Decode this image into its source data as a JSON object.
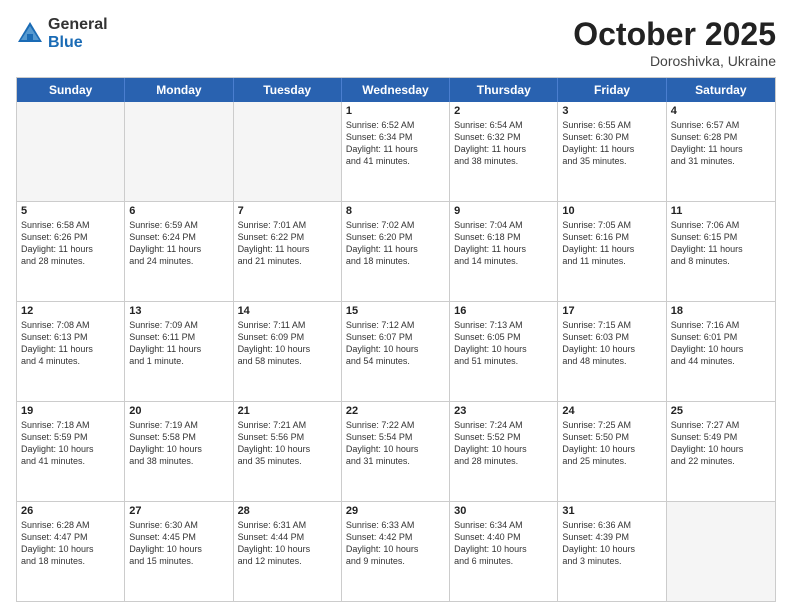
{
  "logo": {
    "general": "General",
    "blue": "Blue"
  },
  "title": "October 2025",
  "location": "Doroshivka, Ukraine",
  "days": [
    "Sunday",
    "Monday",
    "Tuesday",
    "Wednesday",
    "Thursday",
    "Friday",
    "Saturday"
  ],
  "weeks": [
    [
      {
        "day": "",
        "data": ""
      },
      {
        "day": "",
        "data": ""
      },
      {
        "day": "",
        "data": ""
      },
      {
        "day": "1",
        "data": "Sunrise: 6:52 AM\nSunset: 6:34 PM\nDaylight: 11 hours\nand 41 minutes."
      },
      {
        "day": "2",
        "data": "Sunrise: 6:54 AM\nSunset: 6:32 PM\nDaylight: 11 hours\nand 38 minutes."
      },
      {
        "day": "3",
        "data": "Sunrise: 6:55 AM\nSunset: 6:30 PM\nDaylight: 11 hours\nand 35 minutes."
      },
      {
        "day": "4",
        "data": "Sunrise: 6:57 AM\nSunset: 6:28 PM\nDaylight: 11 hours\nand 31 minutes."
      }
    ],
    [
      {
        "day": "5",
        "data": "Sunrise: 6:58 AM\nSunset: 6:26 PM\nDaylight: 11 hours\nand 28 minutes."
      },
      {
        "day": "6",
        "data": "Sunrise: 6:59 AM\nSunset: 6:24 PM\nDaylight: 11 hours\nand 24 minutes."
      },
      {
        "day": "7",
        "data": "Sunrise: 7:01 AM\nSunset: 6:22 PM\nDaylight: 11 hours\nand 21 minutes."
      },
      {
        "day": "8",
        "data": "Sunrise: 7:02 AM\nSunset: 6:20 PM\nDaylight: 11 hours\nand 18 minutes."
      },
      {
        "day": "9",
        "data": "Sunrise: 7:04 AM\nSunset: 6:18 PM\nDaylight: 11 hours\nand 14 minutes."
      },
      {
        "day": "10",
        "data": "Sunrise: 7:05 AM\nSunset: 6:16 PM\nDaylight: 11 hours\nand 11 minutes."
      },
      {
        "day": "11",
        "data": "Sunrise: 7:06 AM\nSunset: 6:15 PM\nDaylight: 11 hours\nand 8 minutes."
      }
    ],
    [
      {
        "day": "12",
        "data": "Sunrise: 7:08 AM\nSunset: 6:13 PM\nDaylight: 11 hours\nand 4 minutes."
      },
      {
        "day": "13",
        "data": "Sunrise: 7:09 AM\nSunset: 6:11 PM\nDaylight: 11 hours\nand 1 minute."
      },
      {
        "day": "14",
        "data": "Sunrise: 7:11 AM\nSunset: 6:09 PM\nDaylight: 10 hours\nand 58 minutes."
      },
      {
        "day": "15",
        "data": "Sunrise: 7:12 AM\nSunset: 6:07 PM\nDaylight: 10 hours\nand 54 minutes."
      },
      {
        "day": "16",
        "data": "Sunrise: 7:13 AM\nSunset: 6:05 PM\nDaylight: 10 hours\nand 51 minutes."
      },
      {
        "day": "17",
        "data": "Sunrise: 7:15 AM\nSunset: 6:03 PM\nDaylight: 10 hours\nand 48 minutes."
      },
      {
        "day": "18",
        "data": "Sunrise: 7:16 AM\nSunset: 6:01 PM\nDaylight: 10 hours\nand 44 minutes."
      }
    ],
    [
      {
        "day": "19",
        "data": "Sunrise: 7:18 AM\nSunset: 5:59 PM\nDaylight: 10 hours\nand 41 minutes."
      },
      {
        "day": "20",
        "data": "Sunrise: 7:19 AM\nSunset: 5:58 PM\nDaylight: 10 hours\nand 38 minutes."
      },
      {
        "day": "21",
        "data": "Sunrise: 7:21 AM\nSunset: 5:56 PM\nDaylight: 10 hours\nand 35 minutes."
      },
      {
        "day": "22",
        "data": "Sunrise: 7:22 AM\nSunset: 5:54 PM\nDaylight: 10 hours\nand 31 minutes."
      },
      {
        "day": "23",
        "data": "Sunrise: 7:24 AM\nSunset: 5:52 PM\nDaylight: 10 hours\nand 28 minutes."
      },
      {
        "day": "24",
        "data": "Sunrise: 7:25 AM\nSunset: 5:50 PM\nDaylight: 10 hours\nand 25 minutes."
      },
      {
        "day": "25",
        "data": "Sunrise: 7:27 AM\nSunset: 5:49 PM\nDaylight: 10 hours\nand 22 minutes."
      }
    ],
    [
      {
        "day": "26",
        "data": "Sunrise: 6:28 AM\nSunset: 4:47 PM\nDaylight: 10 hours\nand 18 minutes."
      },
      {
        "day": "27",
        "data": "Sunrise: 6:30 AM\nSunset: 4:45 PM\nDaylight: 10 hours\nand 15 minutes."
      },
      {
        "day": "28",
        "data": "Sunrise: 6:31 AM\nSunset: 4:44 PM\nDaylight: 10 hours\nand 12 minutes."
      },
      {
        "day": "29",
        "data": "Sunrise: 6:33 AM\nSunset: 4:42 PM\nDaylight: 10 hours\nand 9 minutes."
      },
      {
        "day": "30",
        "data": "Sunrise: 6:34 AM\nSunset: 4:40 PM\nDaylight: 10 hours\nand 6 minutes."
      },
      {
        "day": "31",
        "data": "Sunrise: 6:36 AM\nSunset: 4:39 PM\nDaylight: 10 hours\nand 3 minutes."
      },
      {
        "day": "",
        "data": ""
      }
    ]
  ]
}
